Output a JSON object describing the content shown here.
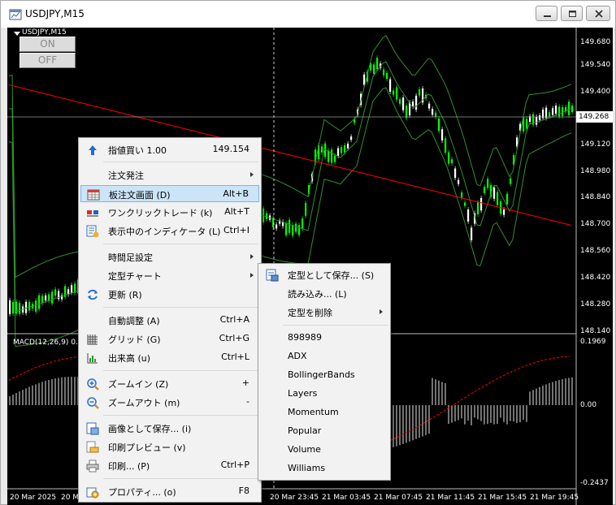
{
  "window": {
    "title": "USDJPY,M15"
  },
  "chart": {
    "symbol_label": "USDJPY,M15",
    "buttons": {
      "on": "ON",
      "off": "OFF"
    },
    "macd_label": "MACD(12,26,9) 0.0",
    "current_price": "149.268",
    "price_axis": [
      "149.680",
      "149.540",
      "149.400",
      "149.120",
      "148.980",
      "148.840",
      "148.700",
      "148.560",
      "148.420",
      "148.280",
      "148.140"
    ],
    "macd_axis": [
      "0.1969",
      "0.00",
      "-0.2437"
    ],
    "time_axis": [
      "20 Mar 2025",
      "20 Ma",
      "20 Mar 23:45",
      "21 Mar 03:45",
      "21 Mar 07:45",
      "21 Mar 11:45",
      "21 Mar 15:45",
      "21 Mar 19:45"
    ],
    "colors": {
      "bull": "#00ff00",
      "bear": "#ffffff",
      "bands": "#2f8f2f",
      "ma": "#ff0000",
      "macd_signal": "#ff0000",
      "macd_hist": "#c0c0c0"
    }
  },
  "context_menu": {
    "items": [
      {
        "id": "limit-buy",
        "icon": "arrow-up-icon",
        "label": "指値買い 1.00",
        "shortcut": "149.154"
      },
      {
        "id": "new-order",
        "label": "注文発注",
        "submenu": true
      },
      {
        "id": "depth-of-market",
        "icon": "dom-table-icon",
        "label": "板注文画面 (D)",
        "shortcut": "Alt+B",
        "highlighted": true
      },
      {
        "id": "one-click-trading",
        "icon": "one-click-icon",
        "label": "ワンクリックトレード (k)",
        "shortcut": "Alt+T"
      },
      {
        "id": "indicators-list",
        "icon": "indicator-list-icon",
        "label": "表示中のインディケータ (L)",
        "shortcut": "Ctrl+I"
      },
      {
        "id": "timeframes",
        "label": "時間足設定",
        "submenu": true
      },
      {
        "id": "template",
        "label": "定型チャート",
        "submenu": true
      },
      {
        "id": "refresh",
        "icon": "refresh-icon",
        "label": "更新 (R)"
      },
      {
        "id": "auto-scroll",
        "label": "自動調整 (A)",
        "shortcut": "Ctrl+A"
      },
      {
        "id": "grid",
        "icon": "grid-icon",
        "label": "グリッド (G)",
        "shortcut": "Ctrl+G"
      },
      {
        "id": "volumes",
        "icon": "volume-icon",
        "label": "出来高 (u)",
        "shortcut": "Ctrl+L"
      },
      {
        "id": "zoom-in",
        "icon": "zoom-in-icon",
        "label": "ズームイン (Z)",
        "shortcut": "+"
      },
      {
        "id": "zoom-out",
        "icon": "zoom-out-icon",
        "label": "ズームアウト (m)",
        "shortcut": "-"
      },
      {
        "id": "save-as-picture",
        "icon": "save-picture-icon",
        "label": "画像として保存... (i)"
      },
      {
        "id": "print-preview",
        "icon": "print-preview-icon",
        "label": "印刷プレビュー (v)"
      },
      {
        "id": "print",
        "icon": "printer-icon",
        "label": "印刷... (P)",
        "shortcut": "Ctrl+P"
      },
      {
        "id": "properties",
        "icon": "properties-icon",
        "label": "プロパティ... (o)",
        "shortcut": "F8"
      }
    ]
  },
  "template_submenu": {
    "items": [
      {
        "id": "save-template",
        "icon": "save-template-icon",
        "label": "定型として保存... (S)"
      },
      {
        "id": "load-template",
        "label": "読み込み... (L)"
      },
      {
        "id": "delete-template",
        "label": "定型を削除",
        "submenu": true
      },
      {
        "id": "tpl-898989",
        "label": "898989"
      },
      {
        "id": "tpl-adx",
        "label": "ADX"
      },
      {
        "id": "tpl-bollinger",
        "label": "BollingerBands"
      },
      {
        "id": "tpl-layers",
        "label": "Layers"
      },
      {
        "id": "tpl-momentum",
        "label": "Momentum"
      },
      {
        "id": "tpl-popular",
        "label": "Popular"
      },
      {
        "id": "tpl-volume",
        "label": "Volume"
      },
      {
        "id": "tpl-williams",
        "label": "Williams"
      }
    ]
  }
}
